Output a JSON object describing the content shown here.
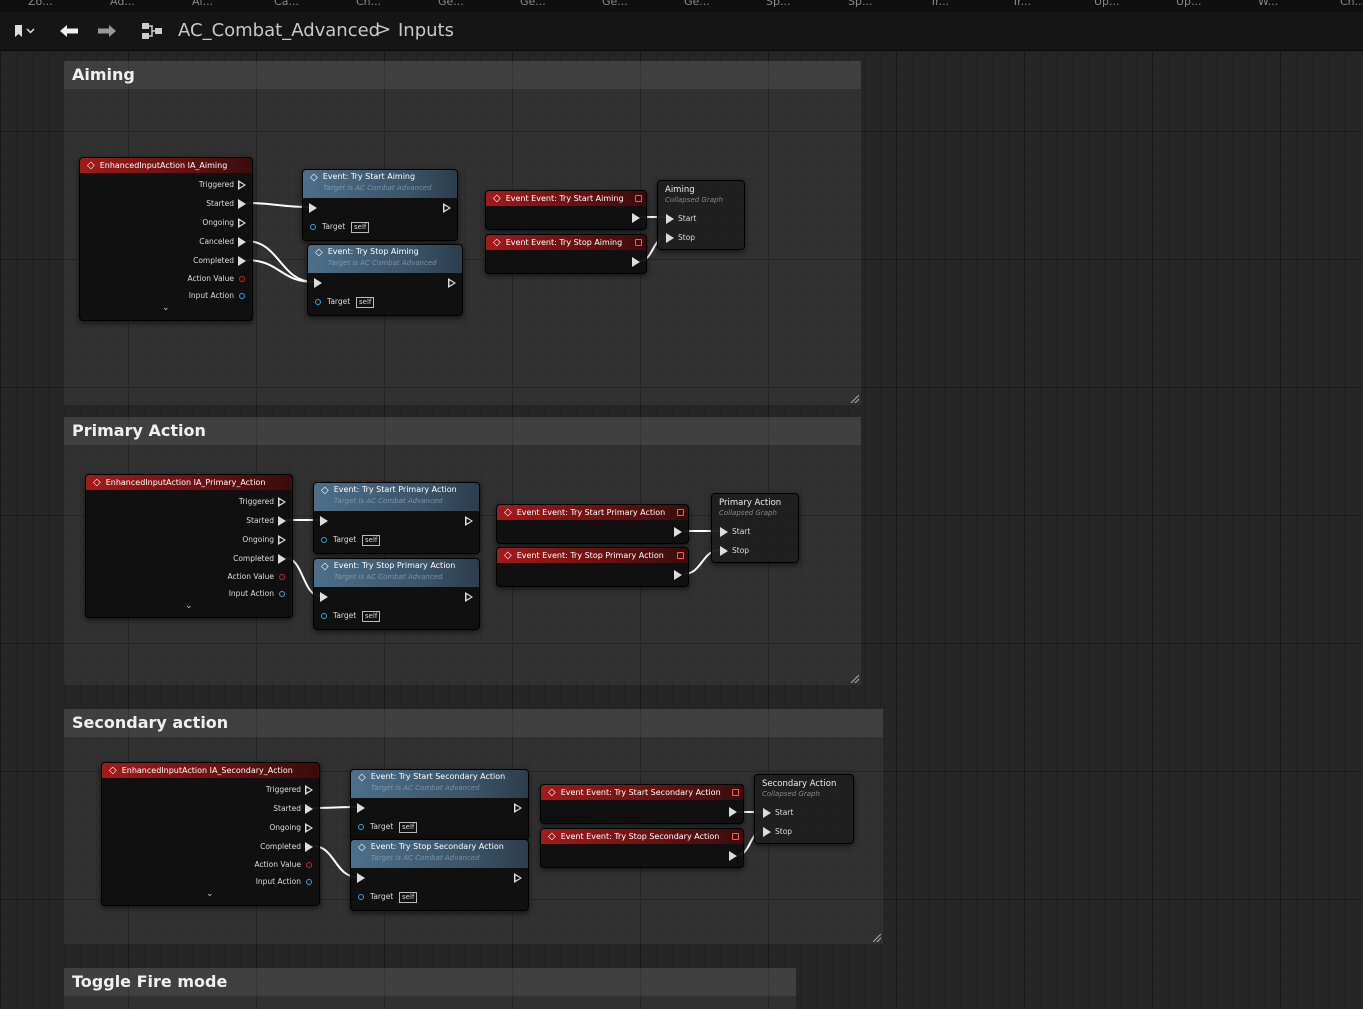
{
  "tabs": [
    "Zo...",
    "Ad...",
    "Ai...",
    "Ca...",
    "Ch...",
    "Ge...",
    "Ge...",
    "Ge...",
    "Ge...",
    "Sp...",
    "Sp...",
    "Tr...",
    "Tr...",
    "Up...",
    "Up...",
    "W...",
    "Ch..."
  ],
  "toolbar": {
    "back": "🡐",
    "forward": "🡒",
    "breadcrumb_root": "AC_Combat_Advanced",
    "breadcrumb_sep": ">",
    "breadcrumb_leaf": "Inputs"
  },
  "common": {
    "triggered": "Triggered",
    "started": "Started",
    "ongoing": "Ongoing",
    "canceled": "Canceled",
    "completed": "Completed",
    "action_value": "Action Value",
    "input_action": "Input Action",
    "target": "Target",
    "self": "self",
    "target_is": "Target is AC Combat Advanced",
    "collapsed_graph": "Collapsed Graph",
    "start": "Start",
    "stop": "Stop",
    "chevron": "⌄"
  },
  "sections": {
    "aiming": {
      "title": "Aiming",
      "input_node": "EnhancedInputAction IA_Aiming",
      "start_call": "Event: Try Start Aiming",
      "stop_call": "Event: Try Stop Aiming",
      "start_event": "Event Event: Try Start Aiming",
      "stop_event": "Event Event: Try Stop Aiming",
      "collapsed": "Aiming"
    },
    "primary": {
      "title": "Primary Action",
      "input_node": "EnhancedInputAction IA_Primary_Action",
      "start_call": "Event: Try Start Primary Action",
      "stop_call": "Event: Try Stop Primary Action",
      "start_event": "Event Event: Try Start Primary Action",
      "stop_event": "Event Event: Try Stop Primary Action",
      "collapsed": "Primary Action"
    },
    "secondary": {
      "title": "Secondary action",
      "input_node": "EnhancedInputAction IA_Secondary_Action",
      "start_call": "Event: Try Start Secondary Action",
      "stop_call": "Event: Try Stop Secondary Action",
      "start_event": "Event Event: Try Start Secondary Action",
      "stop_event": "Event Event: Try Stop Secondary Action",
      "collapsed": "Secondary Action"
    },
    "toggle": {
      "title": "Toggle Fire mode"
    }
  },
  "colors": {
    "input_header": "#a31b1b",
    "call_header": "#4d6f8a",
    "action_value_pin": "#c62828",
    "input_action_pin": "#3aa0d8",
    "target_pin": "#3aa0d8"
  }
}
